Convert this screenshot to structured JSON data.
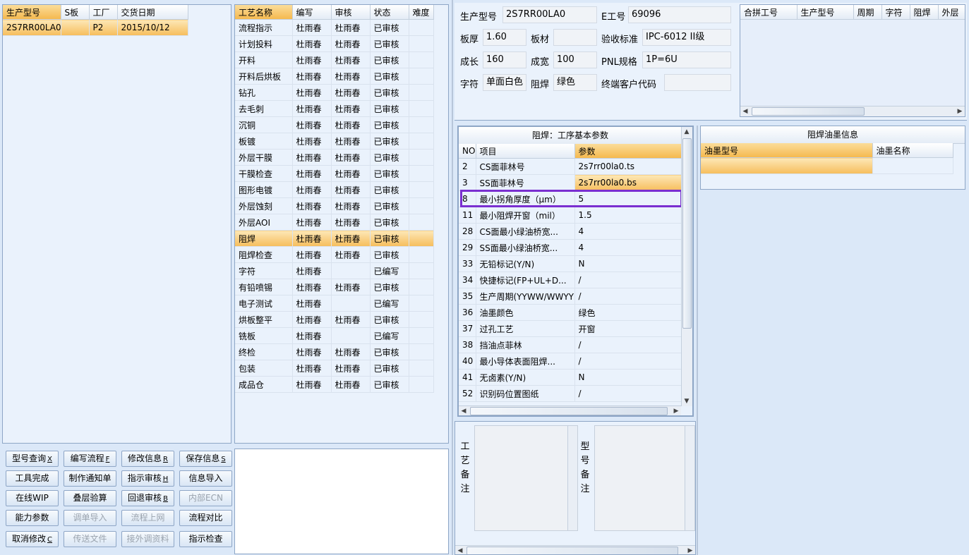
{
  "model_list": {
    "headers": [
      "生产型号",
      "S板",
      "工厂",
      "交货日期"
    ],
    "rows": [
      [
        "2S7RR00LA0",
        "",
        "P2",
        "2015/10/12"
      ]
    ]
  },
  "process_list": {
    "headers": [
      "工艺名称",
      "编写",
      "审核",
      "状态",
      "难度"
    ],
    "rows": [
      [
        "流程指示",
        "杜雨春",
        "杜雨春",
        "已审核",
        ""
      ],
      [
        "计划投料",
        "杜雨春",
        "杜雨春",
        "已审核",
        ""
      ],
      [
        "开料",
        "杜雨春",
        "杜雨春",
        "已审核",
        ""
      ],
      [
        "开料后烘板",
        "杜雨春",
        "杜雨春",
        "已审核",
        ""
      ],
      [
        "钻孔",
        "杜雨春",
        "杜雨春",
        "已审核",
        ""
      ],
      [
        "去毛刺",
        "杜雨春",
        "杜雨春",
        "已审核",
        ""
      ],
      [
        "沉铜",
        "杜雨春",
        "杜雨春",
        "已审核",
        ""
      ],
      [
        "板镀",
        "杜雨春",
        "杜雨春",
        "已审核",
        ""
      ],
      [
        "外层干膜",
        "杜雨春",
        "杜雨春",
        "已审核",
        ""
      ],
      [
        "干膜检查",
        "杜雨春",
        "杜雨春",
        "已审核",
        ""
      ],
      [
        "图形电镀",
        "杜雨春",
        "杜雨春",
        "已审核",
        ""
      ],
      [
        "外层蚀刻",
        "杜雨春",
        "杜雨春",
        "已审核",
        ""
      ],
      [
        "外层AOI",
        "杜雨春",
        "杜雨春",
        "已审核",
        ""
      ],
      [
        "阻焊",
        "杜雨春",
        "杜雨春",
        "已审核",
        ""
      ],
      [
        "阻焊检查",
        "杜雨春",
        "杜雨春",
        "已审核",
        ""
      ],
      [
        "字符",
        "杜雨春",
        "",
        "已编写",
        ""
      ],
      [
        "有铅喷锡",
        "杜雨春",
        "杜雨春",
        "已审核",
        ""
      ],
      [
        "电子测试",
        "杜雨春",
        "",
        "已编写",
        ""
      ],
      [
        "烘板整平",
        "杜雨春",
        "杜雨春",
        "已审核",
        ""
      ],
      [
        "铣板",
        "杜雨春",
        "",
        "已编写",
        ""
      ],
      [
        "终检",
        "杜雨春",
        "杜雨春",
        "已审核",
        ""
      ],
      [
        "包装",
        "杜雨春",
        "杜雨春",
        "已审核",
        ""
      ],
      [
        "成品仓",
        "杜雨春",
        "杜雨春",
        "已审核",
        ""
      ]
    ],
    "selected_row": "阻焊"
  },
  "buttons": {
    "row1": [
      {
        "label": "型号查询",
        "key": "X",
        "enabled": true
      },
      {
        "label": "编写流程",
        "key": "F",
        "enabled": true
      },
      {
        "label": "修改信息",
        "key": "R",
        "enabled": true
      },
      {
        "label": "保存信息",
        "key": "S",
        "enabled": true
      }
    ],
    "row2": [
      {
        "label": "工具完成",
        "key": "",
        "enabled": true
      },
      {
        "label": "制作通知单",
        "key": "",
        "enabled": true
      },
      {
        "label": "指示审核",
        "key": "H",
        "enabled": true
      },
      {
        "label": "信息导入",
        "key": "",
        "enabled": true
      }
    ],
    "row3": [
      {
        "label": "在线WIP",
        "key": "",
        "enabled": true
      },
      {
        "label": "叠层验算",
        "key": "",
        "enabled": true
      },
      {
        "label": "回退审核",
        "key": "B",
        "enabled": true
      },
      {
        "label": "内部ECN",
        "key": "",
        "enabled": false
      }
    ],
    "row4": [
      {
        "label": "能力参数",
        "key": "",
        "enabled": true
      },
      {
        "label": "调单导入",
        "key": "",
        "enabled": false
      },
      {
        "label": "流程上网",
        "key": "",
        "enabled": false
      },
      {
        "label": "流程对比",
        "key": "",
        "enabled": true
      }
    ],
    "row5": [
      {
        "label": "取消修改",
        "key": "C",
        "enabled": true
      },
      {
        "label": "传送文件",
        "key": "",
        "enabled": false
      },
      {
        "label": "接外调资料",
        "key": "",
        "enabled": false
      },
      {
        "label": "指示检查",
        "key": "",
        "enabled": true
      }
    ]
  },
  "info": {
    "model_label": "生产型号",
    "model_value": "2S7RR00LA0",
    "e_label": "E工号",
    "e_value": "69096",
    "thickness_label": "板厚",
    "thickness_value": "1.60",
    "material_label": "板材",
    "material_value": "",
    "standard_label": "验收标准",
    "standard_value": "IPC-6012 II级",
    "length_label": "成长",
    "length_value": "160",
    "width_label": "成宽",
    "width_value": "100",
    "pnl_label": "PNL规格",
    "pnl_value": "1P=6U",
    "char_label": "字符",
    "char_value": "单面白色",
    "mask_label": "阻焊",
    "mask_value": "绿色",
    "customer_label": "终端客户代码",
    "customer_value": ""
  },
  "combine_table": {
    "headers": [
      "合拼工号",
      "生产型号",
      "周期",
      "字符",
      "阻焊",
      "外层"
    ]
  },
  "params": {
    "title": "阻焊：工序基本参数",
    "headers": [
      "NO",
      "项目",
      "参数"
    ],
    "rows": [
      [
        "2",
        "CS面菲林号",
        "2s7rr00la0.ts"
      ],
      [
        "3",
        "SS面菲林号",
        "2s7rr00la0.bs"
      ],
      [
        "8",
        "最小拐角厚度（μm）",
        "5"
      ],
      [
        "11",
        "最小阻焊开窗（mil）",
        "1.5"
      ],
      [
        "28",
        "CS面最小绿油桥宽...",
        "4"
      ],
      [
        "29",
        "SS面最小绿油桥宽...",
        "4"
      ],
      [
        "33",
        "无铅标记(Y/N)",
        "N"
      ],
      [
        "34",
        "快捷标记(FP+UL+D...",
        "/"
      ],
      [
        "35",
        "生产周期(YYWW/WWYY)",
        "/"
      ],
      [
        "36",
        "油墨颜色",
        "绿色"
      ],
      [
        "37",
        "过孔工艺",
        "开窗"
      ],
      [
        "38",
        "挡油点菲林",
        "/"
      ],
      [
        "40",
        "最小导体表面阻焊...",
        "/"
      ],
      [
        "41",
        "无卤素(Y/N)",
        "N"
      ],
      [
        "52",
        "识别码位置图纸",
        "/"
      ]
    ],
    "highlight_color": "#7a2fd0"
  },
  "ink": {
    "title": "阻焊油墨信息",
    "headers": [
      "油墨型号",
      "油墨名称"
    ]
  },
  "notes": {
    "process_note_label": [
      "工",
      "艺",
      "备",
      "注"
    ],
    "model_note_label": [
      "型",
      "号",
      "备",
      "注"
    ]
  }
}
